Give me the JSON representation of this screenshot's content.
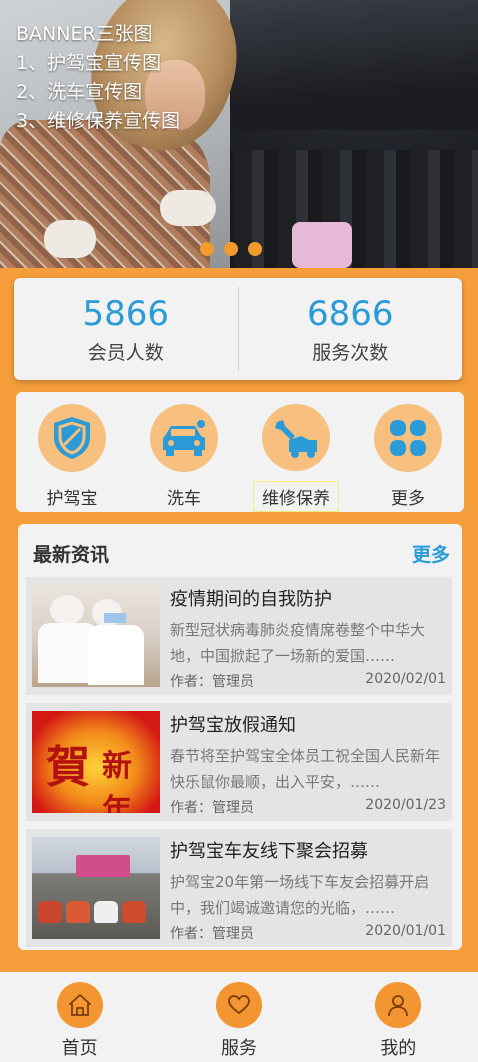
{
  "banner": {
    "lines": [
      "BANNER三张图",
      "1、护驾宝宣传图",
      "2、洗车宣传图",
      "3、维修保养宣传图"
    ],
    "slide_count": 3
  },
  "stats": [
    {
      "value": "5866",
      "label": "会员人数"
    },
    {
      "value": "6866",
      "label": "服务次数"
    }
  ],
  "services": [
    {
      "label": "护驾宝",
      "icon": "shield-icon"
    },
    {
      "label": "洗车",
      "icon": "car-wash-icon"
    },
    {
      "label": "维修保养",
      "icon": "repair-icon"
    },
    {
      "label": "更多",
      "icon": "more-grid-icon"
    }
  ],
  "news": {
    "title": "最新资讯",
    "more": "更多",
    "items": [
      {
        "title": "疫情期间的自我防护",
        "summary": "新型冠状病毒肺炎疫情席卷整个中华大地，中国掀起了一场新的爱国……",
        "author": "作者：管理员",
        "date": "2020/02/01"
      },
      {
        "title": "护驾宝放假通知",
        "summary": "春节将至护驾宝全体员工祝全国人民新年快乐鼠你最顺，出入平安，……",
        "author": "作者：管理员",
        "date": "2020/01/23"
      },
      {
        "title": "护驾宝车友线下聚会招募",
        "summary": "护驾宝20年第一场线下车友会招募开启中，我们竭诚邀请您的光临，……",
        "author": "作者：管理员",
        "date": "2020/01/01"
      }
    ]
  },
  "tabs": [
    {
      "label": "首页",
      "icon": "home-icon"
    },
    {
      "label": "服务",
      "icon": "heart-icon"
    },
    {
      "label": "我的",
      "icon": "user-icon"
    }
  ],
  "colors": {
    "accent": "#f59e3b",
    "blue": "#2b9bd8",
    "icon_circle": "#f7c07e"
  }
}
